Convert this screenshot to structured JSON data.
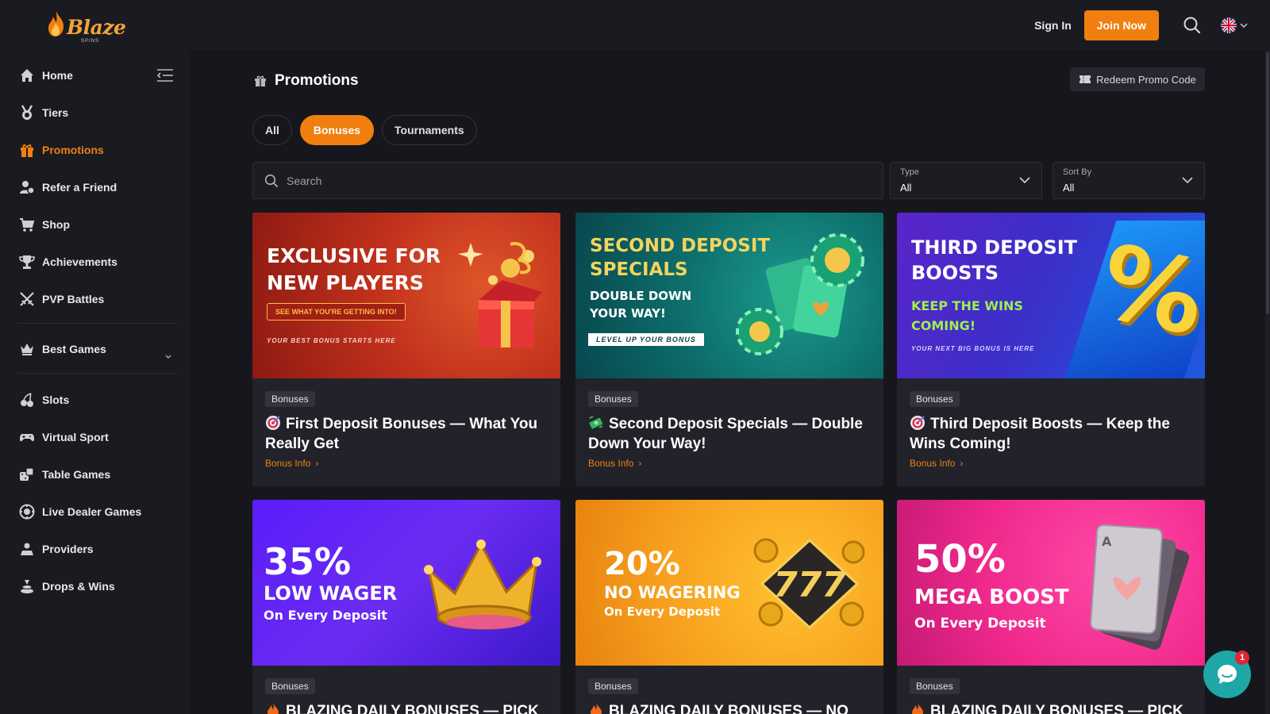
{
  "header": {
    "logo_text": "Blaze",
    "logo_sub": "SPINS",
    "sign_in": "Sign In",
    "join_now": "Join Now"
  },
  "sidebar": {
    "items": [
      {
        "label": "Home",
        "icon": "home-icon"
      },
      {
        "label": "Tiers",
        "icon": "medal-icon"
      },
      {
        "label": "Promotions",
        "icon": "gift-icon",
        "active": true
      },
      {
        "label": "Refer a Friend",
        "icon": "refer-icon"
      },
      {
        "label": "Shop",
        "icon": "cart-icon"
      },
      {
        "label": "Achievements",
        "icon": "trophy-icon"
      },
      {
        "label": "PVP Battles",
        "icon": "swords-icon"
      },
      {
        "label": "Best Games",
        "icon": "crown-icon"
      },
      {
        "label": "Slots",
        "icon": "cherry-icon"
      },
      {
        "label": "Virtual Sport",
        "icon": "gamepad-icon"
      },
      {
        "label": "Table Games",
        "icon": "dice-icon"
      },
      {
        "label": "Live Dealer Games",
        "icon": "chip-icon"
      },
      {
        "label": "Providers",
        "icon": "providers-icon"
      },
      {
        "label": "Drops & Wins",
        "icon": "drops-icon"
      }
    ]
  },
  "main": {
    "title": "Promotions",
    "redeem": "Redeem Promo Code",
    "tabs": [
      "All",
      "Bonuses",
      "Tournaments"
    ],
    "search_placeholder": "Search",
    "filters": {
      "type_label": "Type",
      "type_value": "All",
      "sort_label": "Sort By",
      "sort_value": "All"
    }
  },
  "cards": [
    {
      "badge": "Bonuses",
      "title": "First Deposit Bonuses — What You Really Get",
      "link": "Bonus Info",
      "banner": {
        "line1": "EXCLUSIVE FOR",
        "line2": "NEW PLAYERS",
        "btn": "SEE WHAT YOU'RE GETTING INTO!",
        "foot": "YOUR BEST BONUS STARTS HERE"
      }
    },
    {
      "badge": "Bonuses",
      "title": "Second Deposit Specials — Double Down Your Way!",
      "link": "Bonus Info",
      "banner": {
        "line1": "SECOND DEPOSIT",
        "line2": "SPECIALS",
        "sub1": "DOUBLE DOWN",
        "sub2": "YOUR WAY!",
        "btn": "LEVEL UP YOUR BONUS"
      }
    },
    {
      "badge": "Bonuses",
      "title": "Third Deposit Boosts — Keep the Wins Coming!",
      "link": "Bonus Info",
      "banner": {
        "line1": "THIRD DEPOSIT",
        "line2": "BOOSTS",
        "sub1": "KEEP THE WINS",
        "sub2": "COMING!",
        "foot": "YOUR NEXT BIG BONUS IS HERE",
        "big": "%"
      }
    },
    {
      "badge": "Bonuses",
      "title": "BLAZING DAILY BONUSES — PICK",
      "banner": {
        "pct": "35%",
        "line": "LOW WAGER",
        "sub": "On Every Deposit"
      }
    },
    {
      "badge": "Bonuses",
      "title": "BLAZING DAILY BONUSES — NO",
      "banner": {
        "pct": "20%",
        "line": "NO WAGERING",
        "sub": "On Every Deposit"
      }
    },
    {
      "badge": "Bonuses",
      "title": "BLAZING DAILY BONUSES — PICK",
      "banner": {
        "pct": "50%",
        "line": "MEGA BOOST",
        "sub": "On Every Deposit"
      }
    }
  ],
  "chat": {
    "badge": "1"
  },
  "colors": {
    "accent": "#f07f10",
    "bg": "#16171c",
    "sidebar": "#1a1b21",
    "card": "#22232a"
  }
}
